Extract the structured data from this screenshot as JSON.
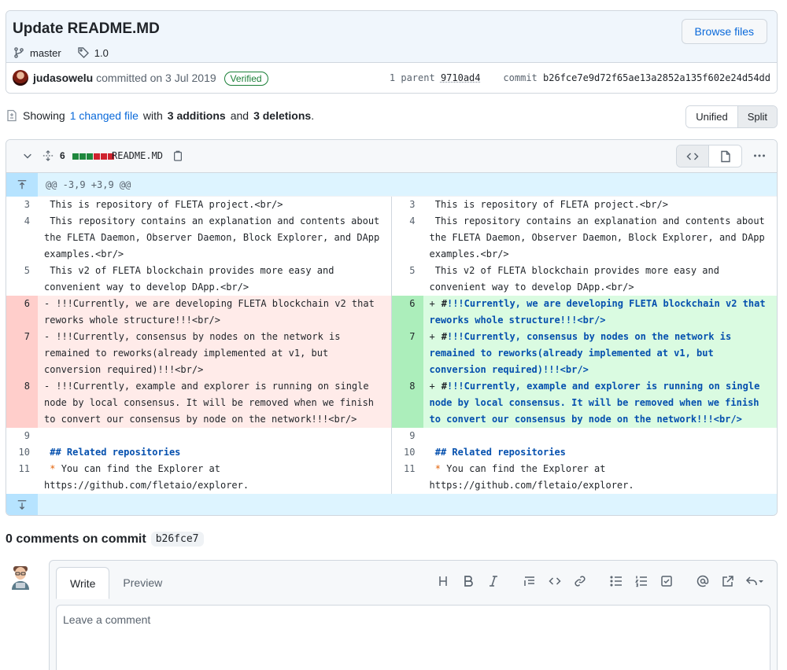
{
  "commit": {
    "title": "Update README.MD",
    "branch": "master",
    "tag": "1.0",
    "browse_label": "Browse files",
    "author": "judasowelu",
    "committed_text": "committed on 3 Jul 2019",
    "verified": "Verified",
    "parent_label": "1 parent",
    "parent_sha": "9710ad4",
    "commit_label": "commit",
    "commit_sha": "b26fce7e9d72f65ae13a2852a135f602e24d54dd"
  },
  "summary": {
    "showing": "Showing",
    "changed": "1 changed file",
    "with": "with",
    "additions": "3 additions",
    "and": "and",
    "deletions": "3 deletions",
    "period": "."
  },
  "view_toggle": {
    "unified": "Unified",
    "split": "Split"
  },
  "file": {
    "count": "6",
    "name": "README.MD",
    "hunk": "@@ -3,9 +3,9 @@",
    "stat_colors": [
      "#1f883d",
      "#1f883d",
      "#1f883d",
      "#cf222e",
      "#cf222e",
      "#cf222e"
    ]
  },
  "diff": {
    "left": [
      {
        "ln": "3",
        "type": "ctx",
        "text": " This is repository of FLETA project.<br/>"
      },
      {
        "ln": "4",
        "type": "ctx",
        "text": " This repository contains an explanation and contents about the FLETA Daemon, Observer Daemon, Block Explorer, and DApp examples.<br/>"
      },
      {
        "ln": "5",
        "type": "ctx",
        "text": " This v2 of FLETA blockchain provides more easy and convenient way to develop DApp.<br/>"
      },
      {
        "ln": "6",
        "type": "del",
        "mark": "-",
        "text": "!!!Currently, we are developing FLETA blockchain v2 that reworks whole structure!!!<br/>"
      },
      {
        "ln": "7",
        "type": "del",
        "mark": "-",
        "text": "!!!Currently, consensus by nodes on the network is remained to reworks(already implemented at v1, but conversion required)!!!<br/>"
      },
      {
        "ln": "8",
        "type": "del",
        "mark": "-",
        "text": "!!!Currently, example and explorer is running on single node by local consensus. It will be removed when we finish to convert our consensus by node on the network!!!<br/>"
      },
      {
        "ln": "9",
        "type": "ctx",
        "text": ""
      },
      {
        "ln": "10",
        "type": "h",
        "text": " ## Related repositories"
      },
      {
        "ln": "11",
        "type": "li",
        "text": " You can find the Explorer at https://github.com/fletaio/explorer."
      }
    ],
    "right": [
      {
        "ln": "3",
        "type": "ctx",
        "text": " This is repository of FLETA project.<br/>"
      },
      {
        "ln": "4",
        "type": "ctx",
        "text": " This repository contains an explanation and contents about the FLETA Daemon, Observer Daemon, Block Explorer, and DApp examples.<br/>"
      },
      {
        "ln": "5",
        "type": "ctx",
        "text": " This v2 of FLETA blockchain provides more easy and convenient way to develop DApp.<br/>"
      },
      {
        "ln": "6",
        "type": "add",
        "mark": "+",
        "hash": "#",
        "text": "!!!Currently, we are developing FLETA blockchain v2 that reworks whole structure!!!<br/>"
      },
      {
        "ln": "7",
        "type": "add",
        "mark": "+",
        "hash": "#",
        "text": "!!!Currently, consensus by nodes on the network is remained to reworks(already implemented at v1, but conversion required)!!!<br/>"
      },
      {
        "ln": "8",
        "type": "add",
        "mark": "+",
        "hash": "#",
        "text": "!!!Currently, example and explorer is running on single node by local consensus. It will be removed when we finish to convert our consensus by node on the network!!!<br/>"
      },
      {
        "ln": "9",
        "type": "ctx",
        "text": ""
      },
      {
        "ln": "10",
        "type": "h",
        "text": " ## Related repositories"
      },
      {
        "ln": "11",
        "type": "li",
        "text": " You can find the Explorer at https://github.com/fletaio/explorer."
      }
    ],
    "bullet": "*"
  },
  "comments": {
    "count_text": "0 comments on commit",
    "sha": "b26fce7",
    "tab_write": "Write",
    "tab_preview": "Preview",
    "placeholder": "Leave a comment"
  }
}
